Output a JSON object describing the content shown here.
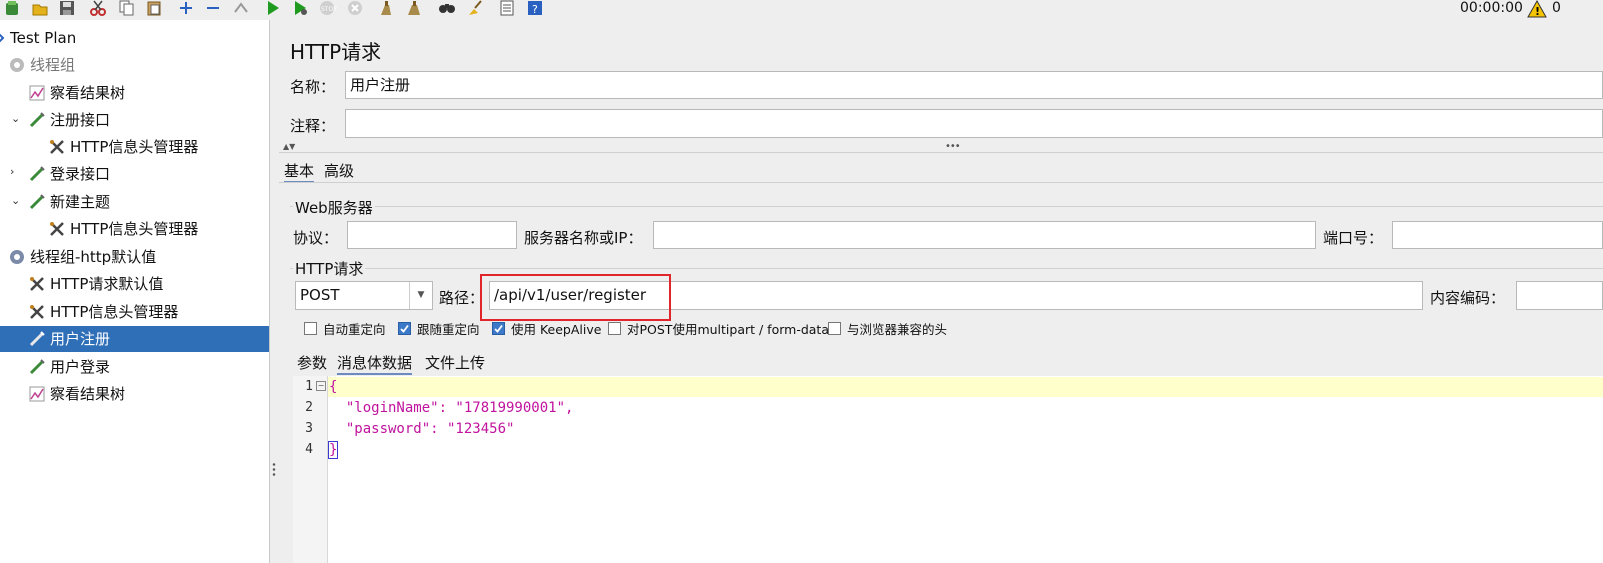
{
  "toolbar": {
    "buttons": [
      {
        "name": "templates-icon",
        "color": "#3a8a3a"
      },
      {
        "name": "open-icon",
        "color": "#d8a400"
      },
      {
        "name": "save-icon",
        "color": "#444"
      },
      {
        "name": "cut-icon",
        "color": "#c03030"
      },
      {
        "name": "copy-icon",
        "color": "#666"
      },
      {
        "name": "paste-icon",
        "color": "#666"
      },
      {
        "name": "expand-icon",
        "color": "#2a60c0"
      },
      {
        "name": "collapse-icon",
        "color": "#2a60c0"
      },
      {
        "name": "toggle-icon",
        "color": "#888"
      },
      {
        "name": "start-icon",
        "color": "#1e9a1e"
      },
      {
        "name": "start-no-pauses-icon",
        "color": "#1e9a1e"
      },
      {
        "name": "stop-icon",
        "color": "#bbbbbb"
      },
      {
        "name": "shutdown-icon",
        "color": "#bbbbbb"
      },
      {
        "name": "clear-icon",
        "color": "#8a6a2a"
      },
      {
        "name": "clear-all-icon",
        "color": "#8a6a2a"
      },
      {
        "name": "search-icon",
        "color": "#333"
      },
      {
        "name": "reset-search-icon",
        "color": "#d8a400"
      },
      {
        "name": "function-helper-icon",
        "color": "#555"
      },
      {
        "name": "help-icon",
        "color": "#2a60c0"
      }
    ],
    "timer": "00:00:00",
    "warning_count": "0"
  },
  "tree": [
    {
      "label": "Test Plan",
      "icon": "test-plan-icon",
      "level": 0,
      "expander": "",
      "selected": false,
      "disabled": false
    },
    {
      "label": "线程组",
      "icon": "thread-group-icon",
      "level": 0,
      "expander": "",
      "selected": false,
      "disabled": true
    },
    {
      "label": "察看结果树",
      "icon": "listener-icon",
      "level": 1,
      "expander": "",
      "selected": false,
      "disabled": false
    },
    {
      "label": "注册接口",
      "icon": "sampler-icon",
      "level": 1,
      "expander": "v",
      "selected": false,
      "disabled": false
    },
    {
      "label": "HTTP信息头管理器",
      "icon": "config-icon",
      "level": 2,
      "expander": "",
      "selected": false,
      "disabled": false
    },
    {
      "label": "登录接口",
      "icon": "sampler-icon",
      "level": 1,
      "expander": ">",
      "selected": false,
      "disabled": false
    },
    {
      "label": "新建主题",
      "icon": "sampler-icon",
      "level": 1,
      "expander": "v",
      "selected": false,
      "disabled": false
    },
    {
      "label": "HTTP信息头管理器",
      "icon": "config-icon",
      "level": 2,
      "expander": "",
      "selected": false,
      "disabled": false
    },
    {
      "label": "线程组-http默认值",
      "icon": "thread-group-icon",
      "level": 0,
      "expander": "",
      "selected": false,
      "disabled": false
    },
    {
      "label": "HTTP请求默认值",
      "icon": "config-icon",
      "level": 1,
      "expander": "",
      "selected": false,
      "disabled": false
    },
    {
      "label": "HTTP信息头管理器",
      "icon": "config-icon",
      "level": 1,
      "expander": "",
      "selected": false,
      "disabled": false
    },
    {
      "label": "用户注册",
      "icon": "sampler-icon",
      "level": 1,
      "expander": "",
      "selected": true,
      "disabled": false
    },
    {
      "label": "用户登录",
      "icon": "sampler-icon",
      "level": 1,
      "expander": "",
      "selected": false,
      "disabled": false
    },
    {
      "label": "察看结果树",
      "icon": "listener-icon",
      "level": 1,
      "expander": "",
      "selected": false,
      "disabled": false
    }
  ],
  "panel": {
    "title": "HTTP请求",
    "name_label": "名称：",
    "name_value": "用户注册",
    "comment_label": "注释：",
    "comment_value": "",
    "tabs": [
      "基本",
      "高级"
    ],
    "web_server": {
      "title": "Web服务器",
      "protocol_label": "协议：",
      "protocol_value": "",
      "server_label": "服务器名称或IP：",
      "server_value": "",
      "port_label": "端口号：",
      "port_value": ""
    },
    "http_request": {
      "title": "HTTP请求",
      "method": "POST",
      "path_label": "路径：",
      "path_value": "/api/v1/user/register",
      "encoding_label": "内容编码：",
      "encoding_value": "",
      "highlight_color": "#e0262a"
    },
    "checkboxes": [
      {
        "label": "自动重定向",
        "checked": false
      },
      {
        "label": "跟随重定向",
        "checked": true
      },
      {
        "label": "使用 KeepAlive",
        "checked": true
      },
      {
        "label": "对POST使用multipart / form-data",
        "checked": false
      },
      {
        "label": "与浏览器兼容的头",
        "checked": false
      }
    ],
    "sub_tabs": [
      "参数",
      "消息体数据",
      "文件上传"
    ],
    "body_lines": [
      {
        "num": "1",
        "text": "{"
      },
      {
        "num": "2",
        "text": "  \"loginName\": \"17819990001\","
      },
      {
        "num": "3",
        "text": "  \"password\": \"123456\""
      },
      {
        "num": "4",
        "text": "}"
      }
    ]
  }
}
